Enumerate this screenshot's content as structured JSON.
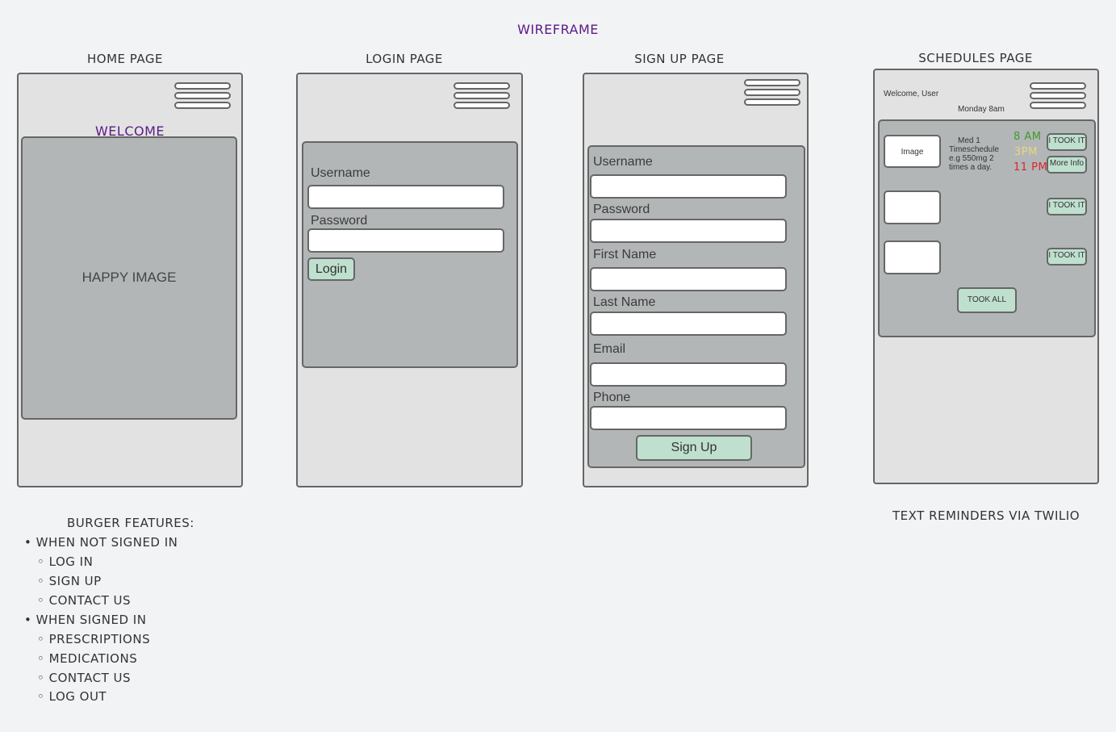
{
  "title": "WIREFRAME",
  "pages": {
    "home": {
      "title": "HOME PAGE",
      "welcome": "WELCOME",
      "image_text": "HAPPY IMAGE"
    },
    "login": {
      "title": "LOGIN PAGE",
      "username_label": "Username",
      "password_label": "Password",
      "login_button": "Login"
    },
    "signup": {
      "title": "SIGN UP PAGE",
      "labels": [
        "Username",
        "Password",
        "First Name",
        "Last Name",
        "Email",
        "Phone"
      ],
      "signup_button": "Sign Up"
    },
    "schedules": {
      "title": "SCHEDULES PAGE",
      "welcome_text": "Welcome, User",
      "date_text": "Monday 8am",
      "image_label": "Image",
      "med_name": "Med 1",
      "med_line2": "Timeschedule",
      "med_line3": "e.g 550mg 2",
      "med_line4": "times a day.",
      "times": [
        "8 AM",
        "3PM",
        "11 PM"
      ],
      "took_it_label": "I TOOK IT",
      "more_info_label": "More Info",
      "took_all_label": "TOOK ALL"
    }
  },
  "burger_features": {
    "heading": "BURGER FEATURES:",
    "not_signed_in": {
      "label": "WHEN NOT SIGNED IN",
      "items": [
        "LOG IN",
        "SIGN UP",
        "CONTACT US"
      ]
    },
    "signed_in": {
      "label": "WHEN SIGNED IN",
      "items": [
        "PRESCRIPTIONS",
        "MEDICATIONS",
        "CONTACT US",
        "LOG OUT"
      ]
    }
  },
  "text_reminders": "TEXT REMINDERS VIA TWILIO",
  "colors": {
    "accent_purple": "#5c1a85",
    "button_green": "#bfe0cf",
    "panel_gray": "#b3b6b7",
    "time_green": "#3e9a2a",
    "time_yellow": "#e9d77a",
    "time_red": "#d9262a"
  }
}
